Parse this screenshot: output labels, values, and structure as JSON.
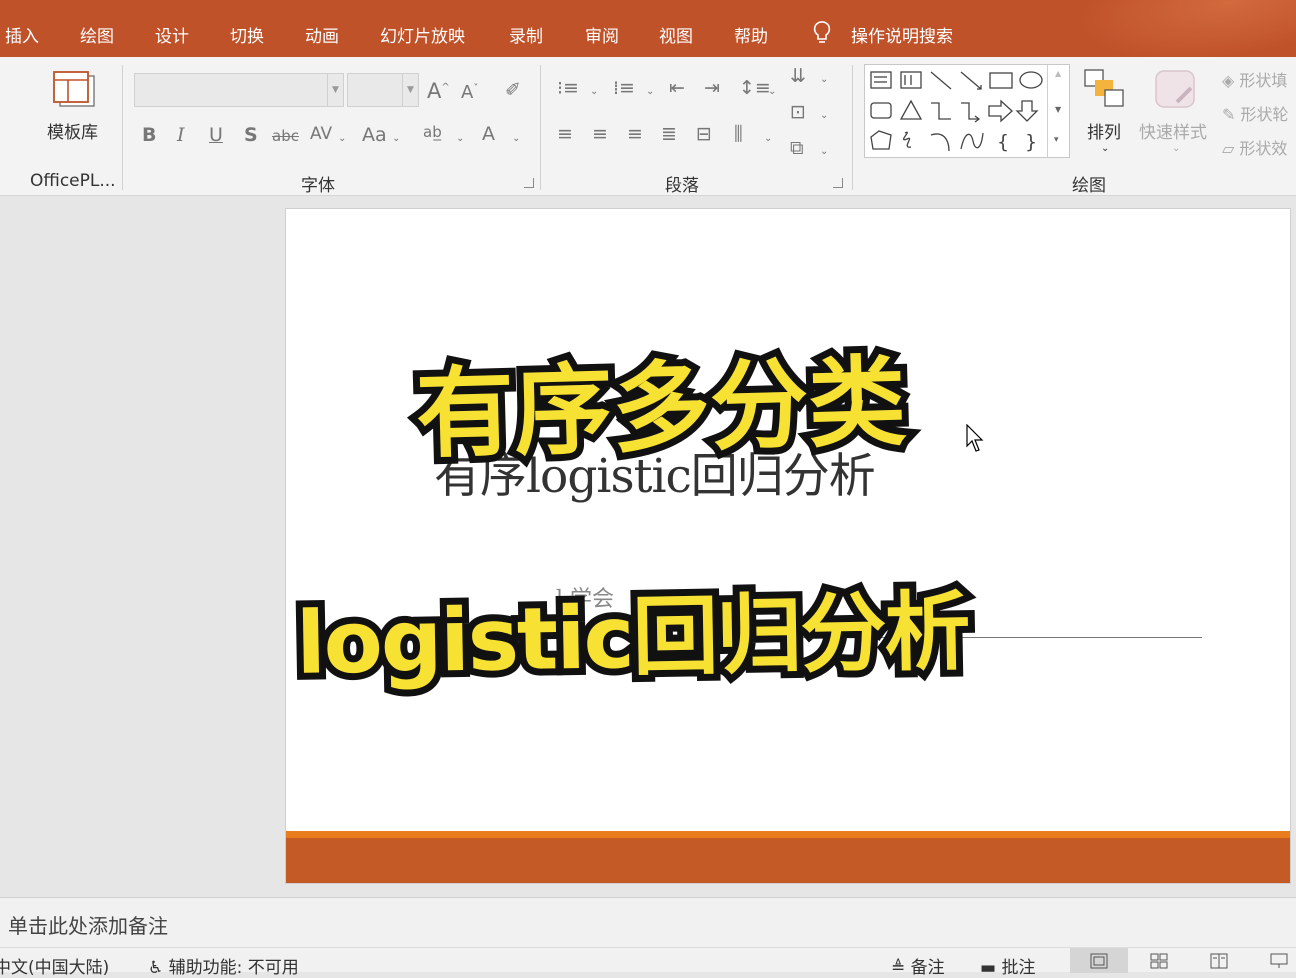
{
  "menu": {
    "tabs": [
      "插入",
      "绘图",
      "设计",
      "切换",
      "动画",
      "幻灯片放映",
      "录制",
      "审阅",
      "视图",
      "帮助"
    ],
    "search": "操作说明搜索"
  },
  "ribbon": {
    "template_label": "模板库",
    "officeplus_label": "OfficePL...",
    "font_group": "字体",
    "paragraph_group": "段落",
    "drawing_group": "绘图",
    "arrange_label": "排列",
    "quick_styles_label": "快速样式",
    "shape_fill": "形状填",
    "shape_outline": "形状轮",
    "shape_effects": "形状效"
  },
  "slide": {
    "subtitle": "有序logistic回归分析",
    "ghost_text": "l    学会",
    "overlay_line1": "有序多分类",
    "overlay_line2": "logistic回归分析",
    "colors": {
      "overlay_fill": "#f7e233",
      "overlay_stroke": "#111111",
      "footer_orange": "#e97d1e",
      "footer_rust": "#c45a26"
    }
  },
  "notes": {
    "placeholder": "单击此处添加备注"
  },
  "status": {
    "language": "中文(中国大陆)",
    "accessibility": "辅助功能: 不可用",
    "notes_btn": "备注",
    "comments_btn": "批注"
  }
}
